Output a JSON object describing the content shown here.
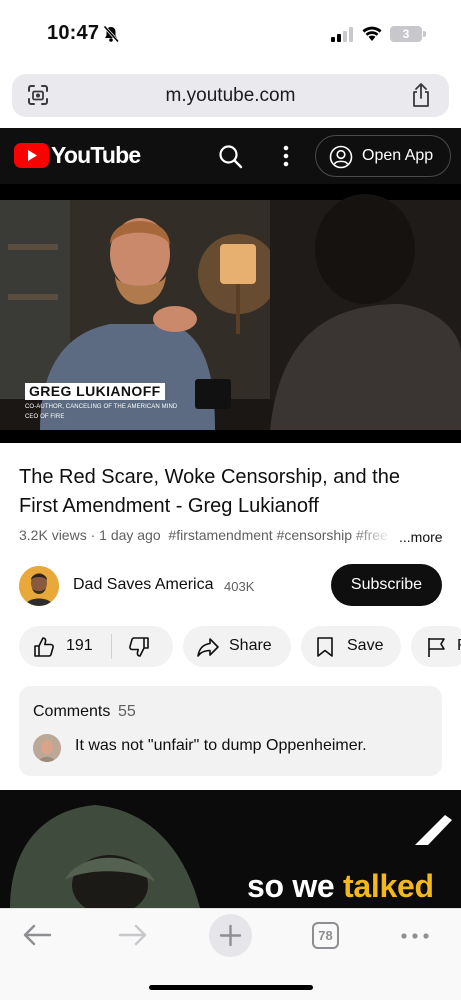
{
  "status_bar": {
    "time": "10:47",
    "battery": "3"
  },
  "browser": {
    "url": "m.youtube.com"
  },
  "yt_header": {
    "wordmark": "YouTube",
    "open_app_label": "Open App"
  },
  "video": {
    "lower_third_name": "GREG LUKIANOFF",
    "lower_third_line1": "CO-AUTHOR, CANCELING OF THE AMERICAN MIND",
    "lower_third_line2": "CEO OF FIRE"
  },
  "video_info": {
    "title": "The Red Scare, Woke Censorship, and the First Amendment - Greg Lukianoff",
    "views": "3.2K views · 1 day ago",
    "tags": "#firstamendment #censorship #free",
    "more": "...more"
  },
  "channel": {
    "name": "Dad Saves America",
    "subscribers": "403K",
    "subscribe_label": "Subscribe"
  },
  "actions": {
    "likes": "191",
    "share_label": "Share",
    "save_label": "Save",
    "report_label": "R"
  },
  "comments": {
    "heading": "Comments",
    "count": "55",
    "top_comment": "It was not \"unfair\" to dump Oppenheimer."
  },
  "next_video": {
    "caption_white": "so we ",
    "caption_highlight": "talked"
  },
  "toolbar": {
    "tab_count": "78"
  },
  "colors": {
    "youtube_red": "#ff0000",
    "header_bg": "#0f0f0f",
    "subscribe_bg": "#0f0f0f",
    "pill_bg": "#f2f2f2",
    "caption_highlight": "#f2b81e"
  },
  "icons": [
    "bell-off-icon",
    "cellular-signal-icon",
    "wifi-icon",
    "battery-icon",
    "page-camera-icon",
    "share-icon",
    "youtube-play-icon",
    "search-icon",
    "kebab-menu-icon",
    "person-icon",
    "thumbs-up-icon",
    "thumbs-down-icon",
    "share-arrow-icon",
    "bookmark-icon",
    "flag-icon",
    "back-arrow-icon",
    "forward-arrow-icon",
    "plus-icon",
    "tabs-icon",
    "more-icon"
  ]
}
